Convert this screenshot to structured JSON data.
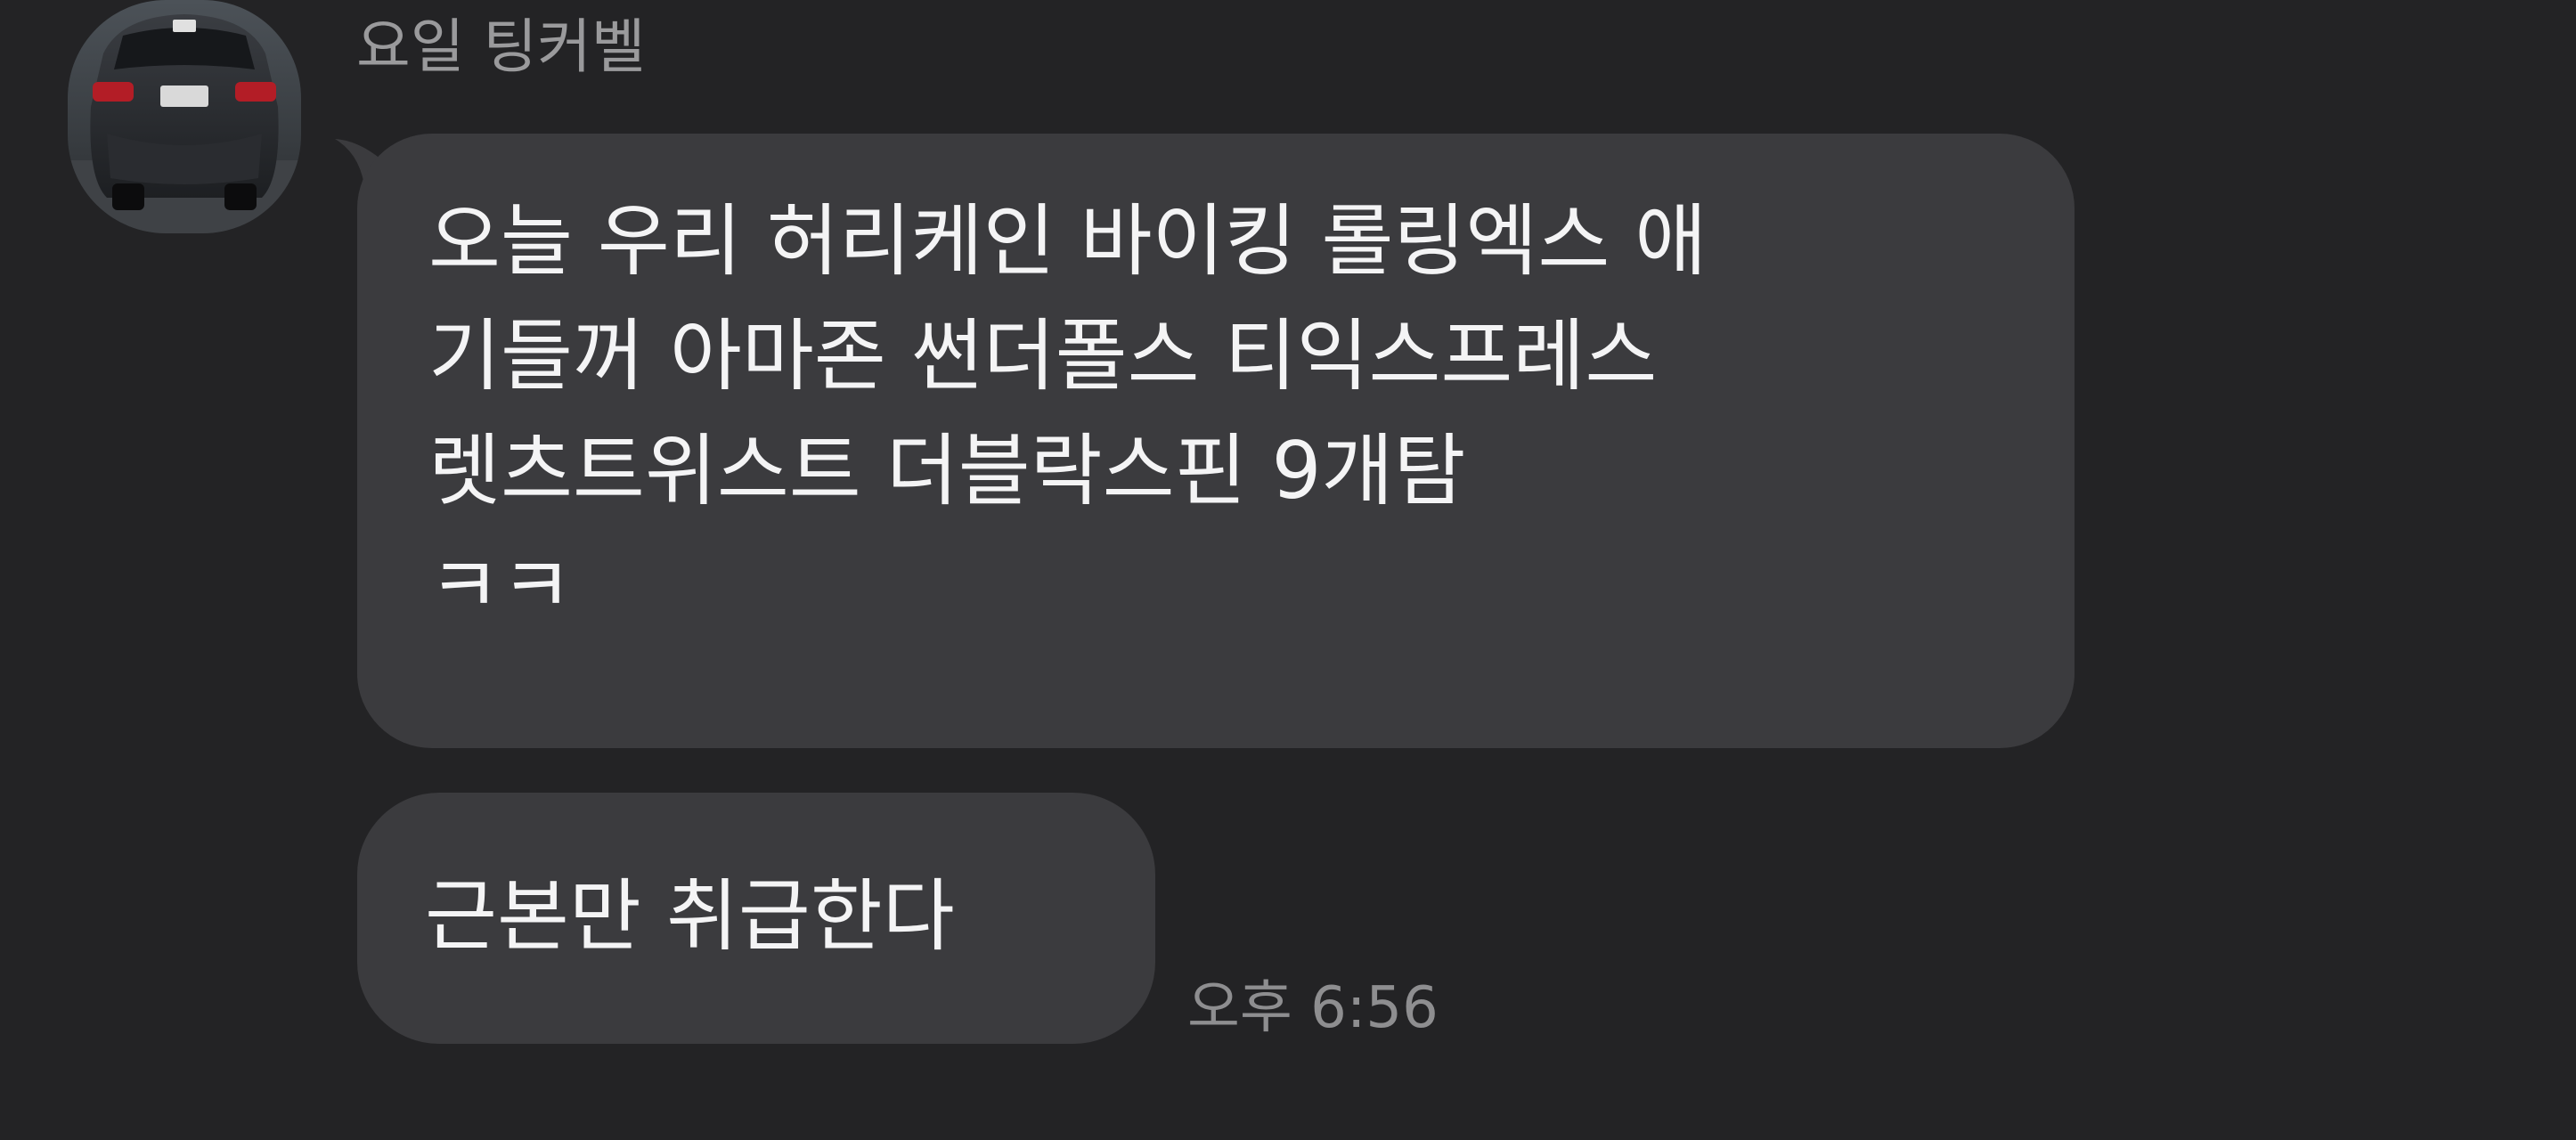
{
  "sender": {
    "name": "요일 팅커벨",
    "avatar": "profile-photo-car-rear"
  },
  "messages": [
    {
      "lines": [
        "오늘 우리 허리케인 바이킹 롤링엑스 애",
        "기들꺼 아마존 썬더폴스 티익스프레스",
        "렛츠트위스트 더블락스핀 9개탐",
        "ㅋㅋ"
      ]
    },
    {
      "lines": [
        "근본만 취급한다"
      ]
    }
  ],
  "timestamp": "오후 6:56",
  "colors": {
    "background": "#232325",
    "bubble": "#3b3b3e",
    "text": "#f4f4f5",
    "meta_text": "#8e8e90"
  }
}
